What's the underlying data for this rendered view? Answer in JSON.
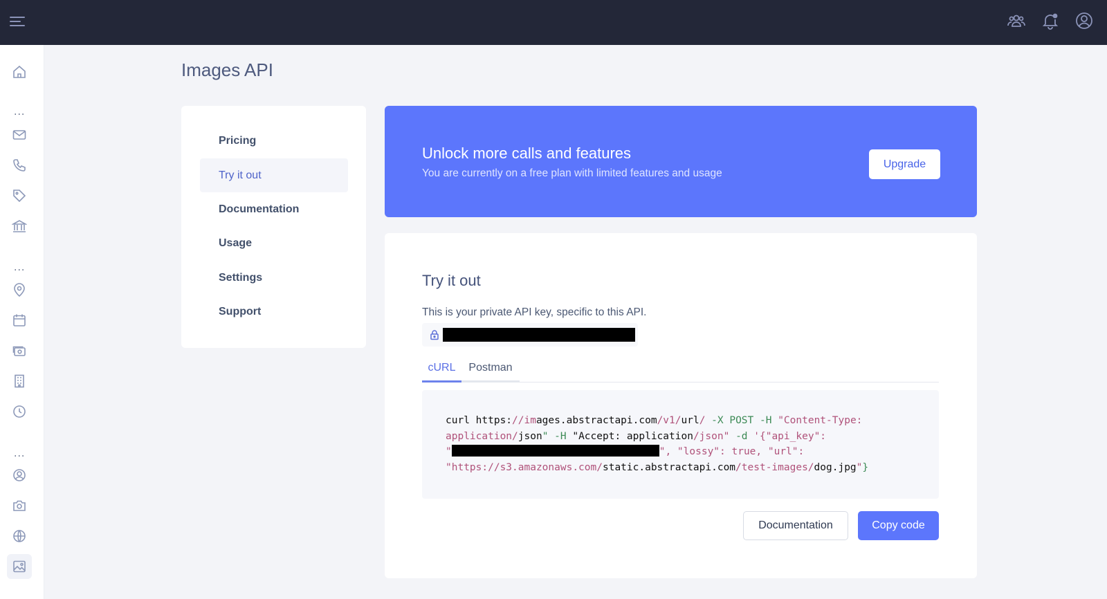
{
  "page": {
    "title": "Images API"
  },
  "topbar": {
    "menu_icon": "hamburger-menu-icon",
    "right_icons": [
      "team-icon",
      "notification-bell-icon",
      "account-circle-icon"
    ]
  },
  "sidenav": {
    "groups_separator": "...",
    "icons": [
      "home-icon",
      "mail-icon",
      "phone-icon",
      "tag-icon",
      "bank-icon",
      "location-pin-icon",
      "calendar-icon",
      "currency-icon",
      "building-icon",
      "clock-icon",
      "user-circle-icon",
      "camera-icon",
      "globe-icon",
      "image-icon"
    ],
    "active": "image-icon"
  },
  "left_menu": {
    "items": [
      {
        "label": "Pricing"
      },
      {
        "label": "Try it out",
        "active": true
      },
      {
        "label": "Documentation"
      },
      {
        "label": "Usage"
      },
      {
        "label": "Settings"
      },
      {
        "label": "Support"
      }
    ]
  },
  "banner": {
    "title": "Unlock more calls and features",
    "subtitle": "You are currently on a free plan with limited features and usage",
    "upgrade_label": "Upgrade"
  },
  "try_it_out": {
    "title": "Try it out",
    "description": "This is your private API key, specific to this API.",
    "tabs": [
      {
        "label": "cURL",
        "active": true
      },
      {
        "label": "Postman"
      }
    ],
    "code": {
      "l1_a": "curl https:",
      "l1_b": "//im",
      "l1_c": "ages.abstractapi.com",
      "l1_d": "/v1/",
      "l1_e": "url",
      "l1_f": "/",
      "l1_g": " -X POST -H ",
      "l1_h": "\"Content-Type:",
      "l2_a": "application/",
      "l2_b": "json",
      "l2_c": "\" -H ",
      "l2_d": "\"Accept: application",
      "l2_e": "/json\"",
      "l2_f": " -d ",
      "l2_g": "'{\"api_key\":",
      "l3_a": "\"",
      "l3_b": "\", \"lossy\": true, \"url\":",
      "l4_a": "\"https://s3.amazonaws.com/",
      "l4_b": "static.abstractapi.com",
      "l4_c": "/test-images/",
      "l4_d": "dog.jpg",
      "l4_e": "\"",
      "l4_f": "}"
    },
    "documentation_label": "Documentation",
    "copy_label": "Copy code"
  },
  "colors": {
    "accent": "#5c76fc",
    "topbar": "#232738",
    "code_string": "#b0527a"
  }
}
